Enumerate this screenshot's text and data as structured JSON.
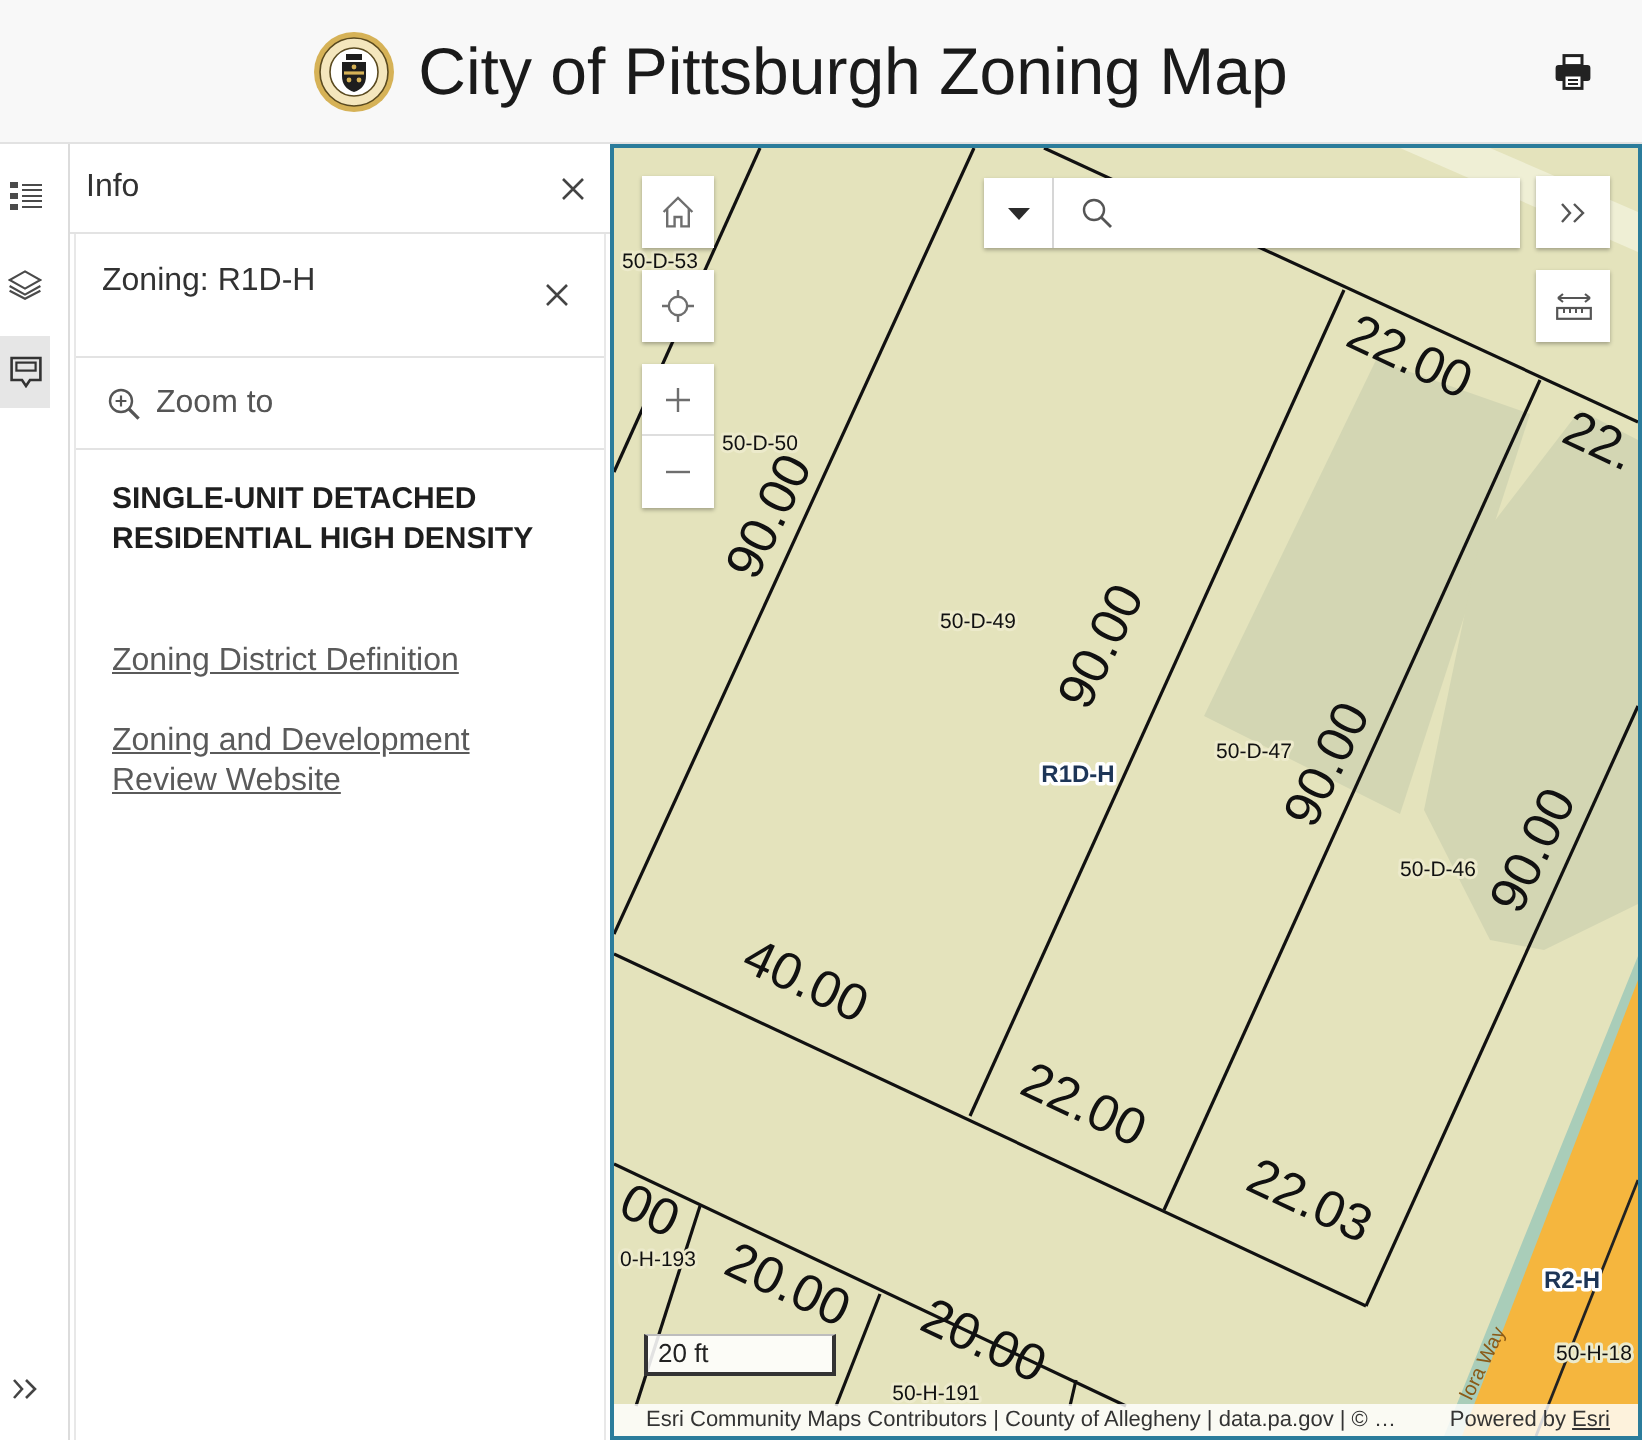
{
  "header": {
    "title": "City of Pittsburgh Zoning Map"
  },
  "rail": {
    "items": [
      {
        "kind": "legend",
        "selected": false
      },
      {
        "kind": "layers",
        "selected": false
      },
      {
        "kind": "info",
        "selected": true
      }
    ]
  },
  "info_panel": {
    "title": "Info",
    "feature": {
      "title": "Zoning: R1D-H",
      "zoom_label": "Zoom to",
      "heading": "SINGLE-UNIT DETACHED RESIDENTIAL HIGH DENSITY",
      "links": [
        "Zoning District Definition",
        "Zoning and Development Review Website"
      ]
    }
  },
  "map": {
    "labels": [
      {
        "text": "50-D-53",
        "kind": "parcel"
      },
      {
        "text": "50-D-50",
        "kind": "parcel"
      },
      {
        "text": "90.00",
        "kind": "dimension"
      },
      {
        "text": "50-D-49",
        "kind": "parcel"
      },
      {
        "text": "90.00",
        "kind": "dimension"
      },
      {
        "text": "R1D-H",
        "kind": "zone"
      },
      {
        "text": "50-D-47",
        "kind": "parcel"
      },
      {
        "text": "90.00",
        "kind": "dimension"
      },
      {
        "text": "50-D-46",
        "kind": "parcel"
      },
      {
        "text": "90.00",
        "kind": "dimension"
      },
      {
        "text": "22.00",
        "kind": "dimension"
      },
      {
        "text": "22.",
        "kind": "dimension"
      },
      {
        "text": "40.00",
        "kind": "dimension"
      },
      {
        "text": "22.00",
        "kind": "dimension"
      },
      {
        "text": "22.03",
        "kind": "dimension"
      },
      {
        "text": "00",
        "kind": "dimension"
      },
      {
        "text": "0-H-193",
        "kind": "parcel"
      },
      {
        "text": "20.00",
        "kind": "dimension"
      },
      {
        "text": "20.00",
        "kind": "dimension"
      },
      {
        "text": "50-H-191",
        "kind": "parcel"
      },
      {
        "text": "R2-H",
        "kind": "zone"
      },
      {
        "text": "50-H-18",
        "kind": "parcel"
      },
      {
        "text": "lora Way",
        "kind": "street"
      }
    ],
    "scale_bar": "20 ft",
    "attribution": {
      "sources": "Esri Community Maps Contributors | County of Allegheny | data.pa.gov | © …",
      "powered_by": "Powered by",
      "link": "Esri"
    }
  }
}
